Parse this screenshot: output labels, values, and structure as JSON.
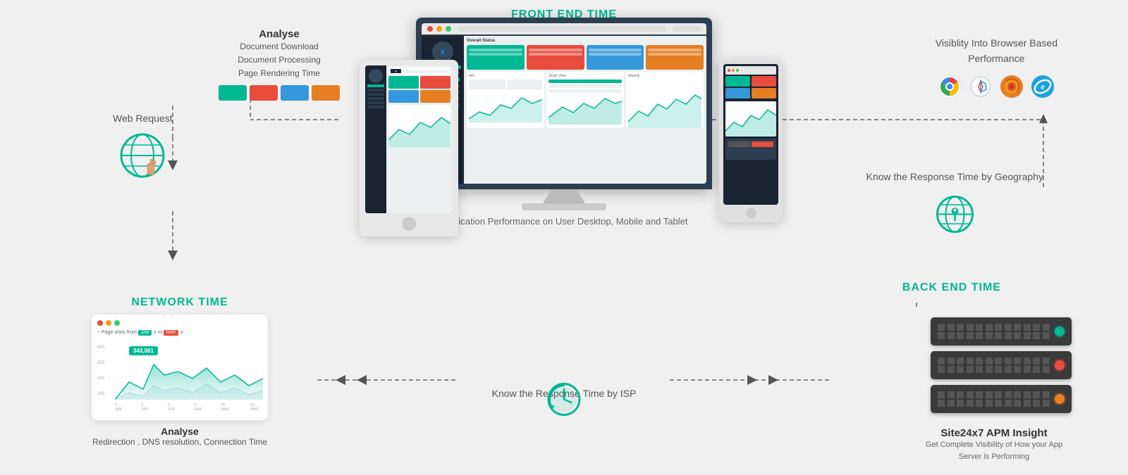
{
  "frontEndTime": {
    "label": "FRONT END TIME",
    "caption": "Application Performance on User Desktop, Mobile and Tablet"
  },
  "networkTime": {
    "label": "NETWORK TIME",
    "chartTitle": "Page visits from",
    "from": "JAN",
    "to": "MAR",
    "value": "343,061",
    "analyse": {
      "title": "Analyse",
      "sub": "Redirection , DNS resolution, Connection Time"
    }
  },
  "backEndTime": {
    "label": "BACK END TIME",
    "site247": {
      "title": "Site24x7 APM Insight",
      "sub": "Get Complete Visibility of How your App Server is Performing"
    }
  },
  "webRequest": {
    "label": "Web Request"
  },
  "analyse": {
    "title": "Analyse",
    "lines": [
      "Document Download",
      "Document Processing",
      "Page Rendering Time"
    ]
  },
  "visibility": {
    "text": "Visiblity Into Browser Based\nPerformance"
  },
  "responseRight": {
    "text": "Know the Response Time\nby Geography"
  },
  "isp": {
    "text": "Know the Response Time by ISP"
  },
  "browsers": [
    "chrome",
    "safari",
    "firefox",
    "ie"
  ],
  "servers": [
    {
      "indicator": "green"
    },
    {
      "indicator": "red"
    },
    {
      "indicator": "orange"
    }
  ]
}
